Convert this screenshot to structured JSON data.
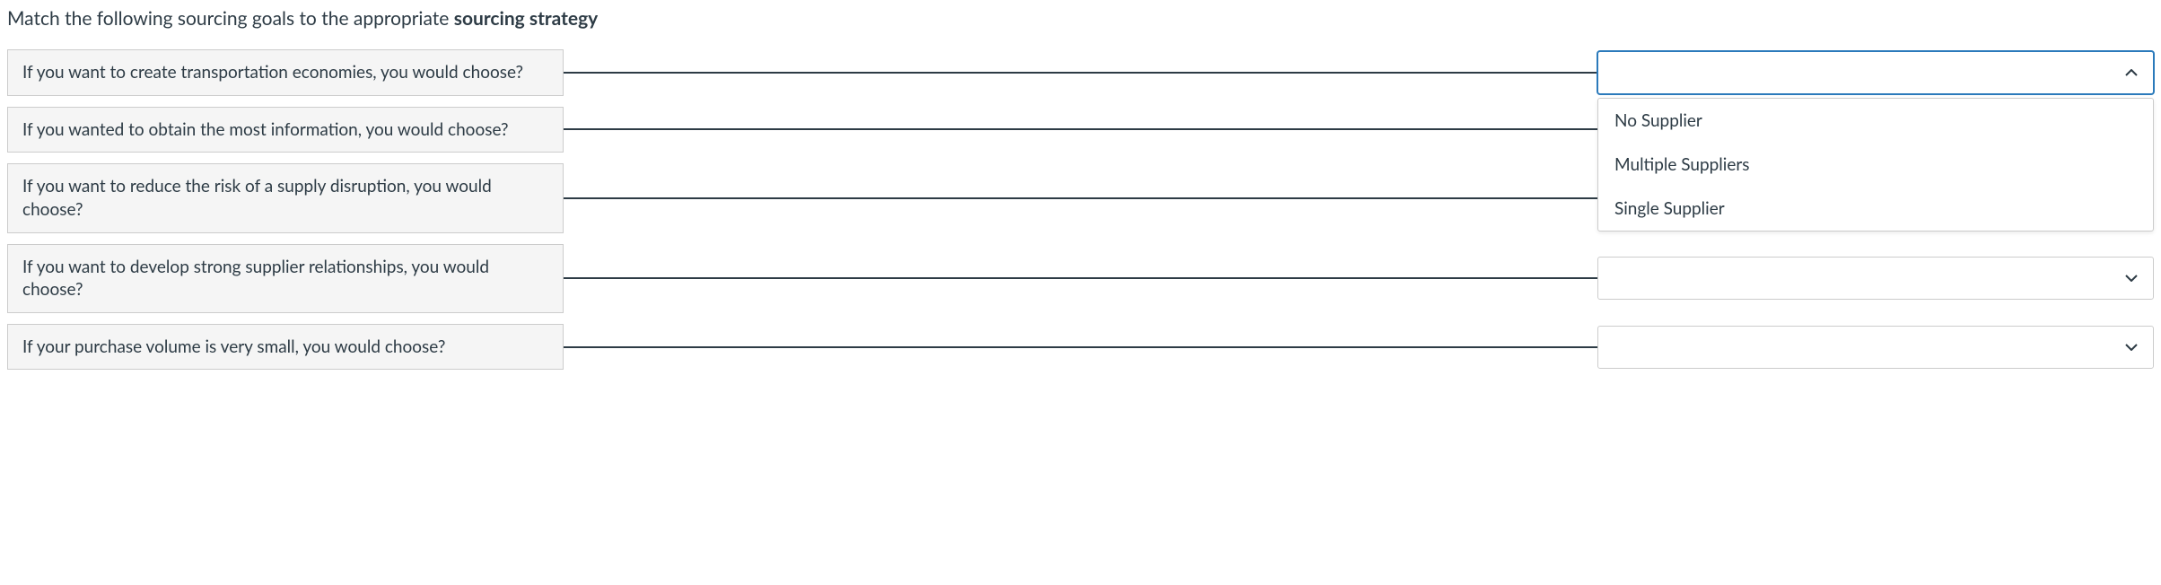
{
  "instruction_prefix": "Match the following sourcing goals to the appropriate ",
  "instruction_bold": "sourcing strategy",
  "questions": [
    "If you want to create transportation economies, you would choose?",
    "If you wanted to obtain the most information, you would choose?",
    "If you want to reduce the risk of a supply disruption, you would choose?",
    "If you want to develop strong supplier relationships, you would choose?",
    "If your purchase volume is very small, you would choose?"
  ],
  "dropdown_options": [
    "No Supplier",
    "Multiple Suppliers",
    "Single Supplier"
  ],
  "open_dropdown_index": 0
}
